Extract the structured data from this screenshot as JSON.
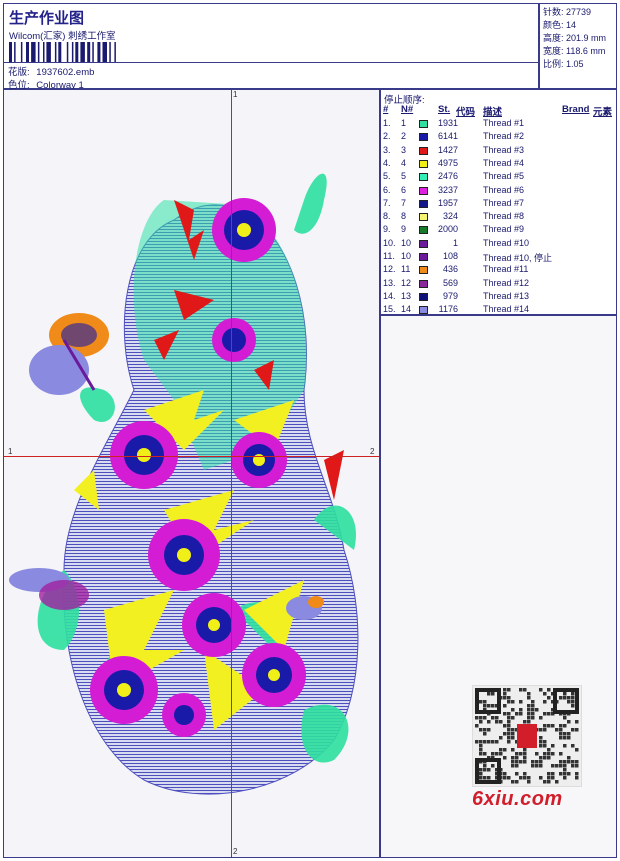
{
  "header": {
    "title": "生产作业图",
    "studio": "Wilcom(汇家) 刺绣工作室",
    "design_label": "花版:",
    "design_file": "1937602.emb",
    "colorway_label": "色位:",
    "colorway": "Colorway 1"
  },
  "stats": [
    {
      "label": "针数:",
      "value": "27739"
    },
    {
      "label": "颜色:",
      "value": "14"
    },
    {
      "label": "高度:",
      "value": "201.9 mm"
    },
    {
      "label": "宽度:",
      "value": "118.6 mm"
    },
    {
      "label": "比例:",
      "value": "1.05"
    }
  ],
  "thread_table": {
    "stop_sequence_label": "停止顺序:",
    "headers": {
      "num": "#",
      "n": "N#",
      "st": "St.",
      "code": "代码",
      "desc": "描述",
      "brand": "Brand",
      "element": "元素"
    },
    "rows": [
      {
        "num": "1.",
        "n": "1",
        "color": "#2fe0a0",
        "st": "1931",
        "desc": "Thread #1"
      },
      {
        "num": "2.",
        "n": "2",
        "color": "#1a1aa8",
        "st": "6141",
        "desc": "Thread #2"
      },
      {
        "num": "3.",
        "n": "3",
        "color": "#e01818",
        "st": "1427",
        "desc": "Thread #3"
      },
      {
        "num": "4.",
        "n": "4",
        "color": "#f0f018",
        "st": "4975",
        "desc": "Thread #4"
      },
      {
        "num": "5.",
        "n": "5",
        "color": "#30f0b8",
        "st": "2476",
        "desc": "Thread #5"
      },
      {
        "num": "6.",
        "n": "6",
        "color": "#e020e0",
        "st": "3237",
        "desc": "Thread #6"
      },
      {
        "num": "7.",
        "n": "7",
        "color": "#16168c",
        "st": "1957",
        "desc": "Thread #7"
      },
      {
        "num": "8.",
        "n": "8",
        "color": "#f4f470",
        "st": "324",
        "desc": "Thread #8"
      },
      {
        "num": "9.",
        "n": "9",
        "color": "#157a2a",
        "st": "2000",
        "desc": "Thread #9"
      },
      {
        "num": "10.",
        "n": "10",
        "color": "#6a1a9a",
        "st": "1",
        "desc": "Thread #10"
      },
      {
        "num": "11.",
        "n": "10",
        "color": "#6a1a9a",
        "st": "108",
        "desc": "Thread  #10, 停止"
      },
      {
        "num": "12.",
        "n": "11",
        "color": "#f08a18",
        "st": "436",
        "desc": "Thread #11"
      },
      {
        "num": "13.",
        "n": "12",
        "color": "#8a2a9a",
        "st": "569",
        "desc": "Thread #12"
      },
      {
        "num": "14.",
        "n": "13",
        "color": "#10107a",
        "st": "979",
        "desc": "Thread #13"
      },
      {
        "num": "15.",
        "n": "14",
        "color": "#8a8ae0",
        "st": "1176",
        "desc": "Thread #14"
      }
    ]
  },
  "axes": {
    "top": "1",
    "bottom": "2",
    "left": "1",
    "right": "2"
  },
  "watermark": {
    "text": "6xiu.com"
  }
}
